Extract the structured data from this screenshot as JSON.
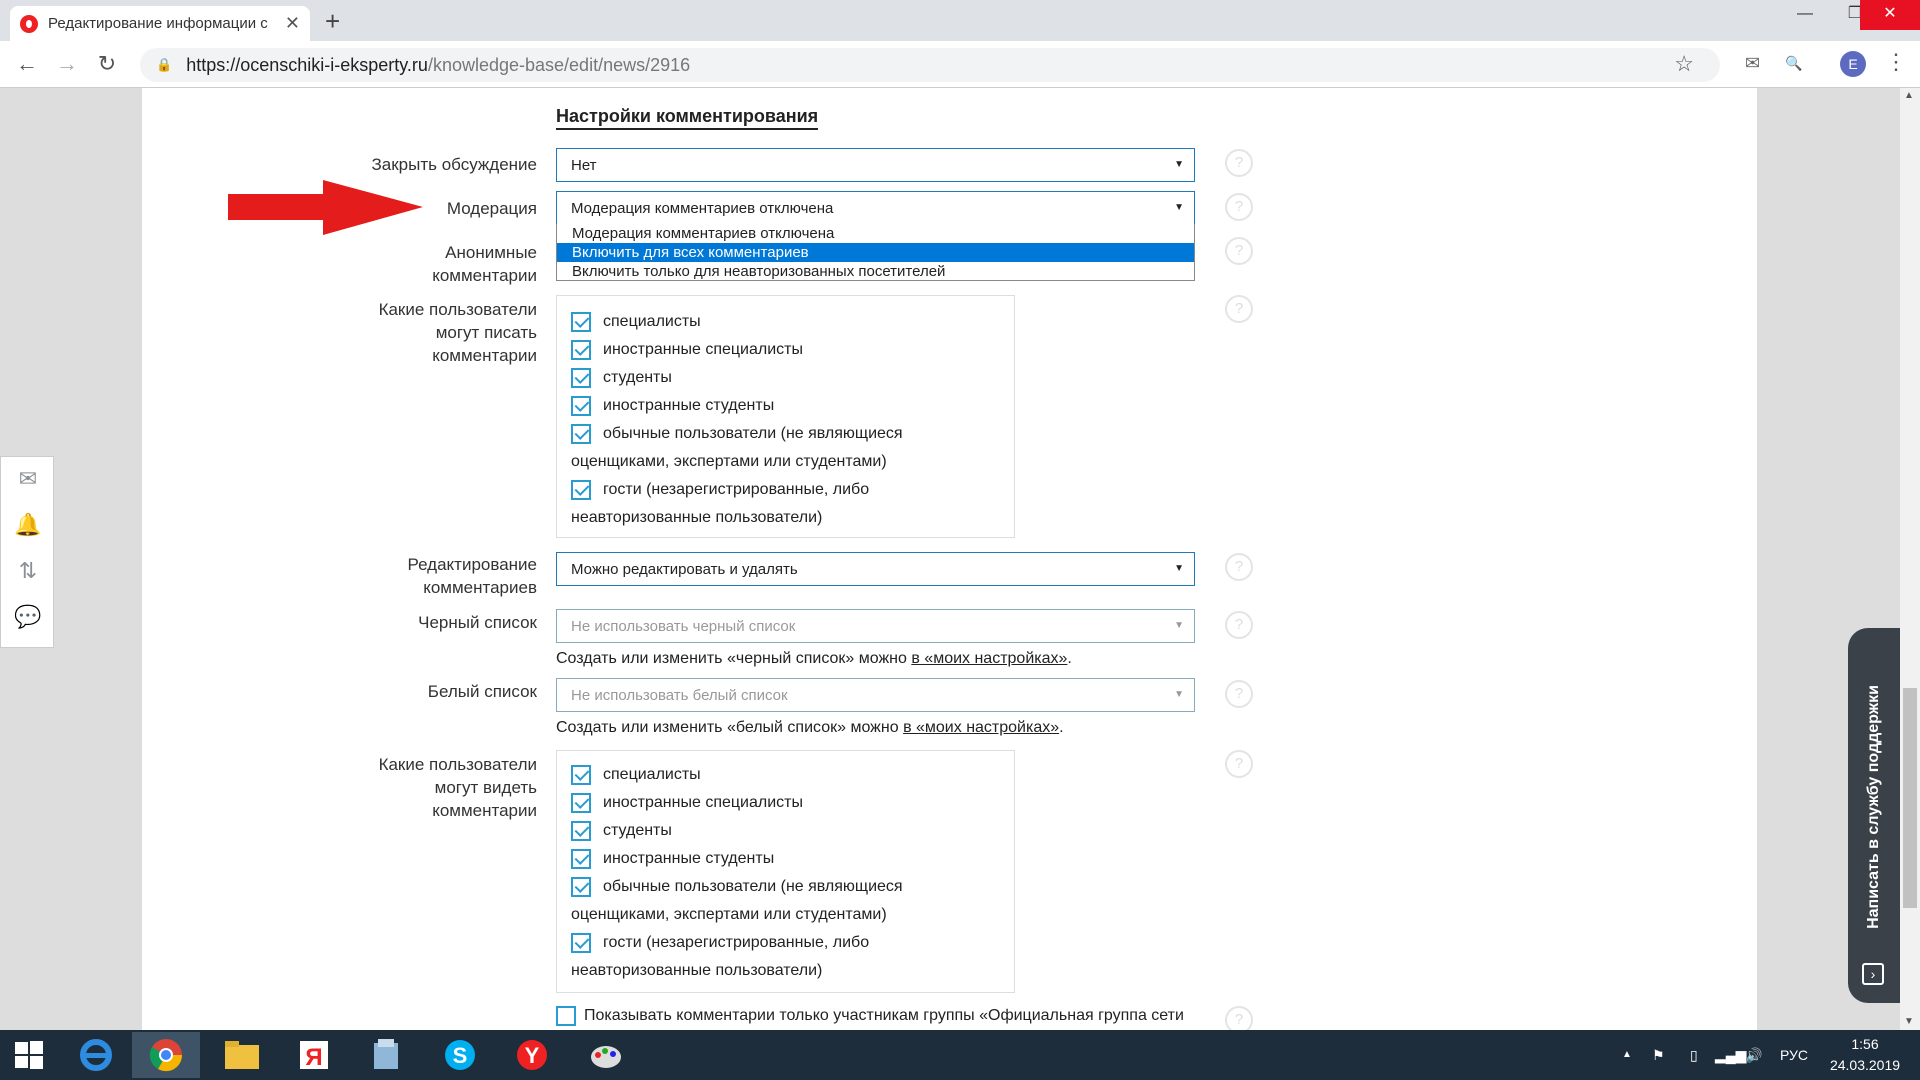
{
  "browser": {
    "tab_title": "Редактирование информации с",
    "url_host": "https://ocenschiki-i-eksperty.ru",
    "url_path": "/knowledge-base/edit/news/2916",
    "profile_initial": "E"
  },
  "page": {
    "section_title": "Настройки комментирования",
    "close_discussion": {
      "label": "Закрыть обсуждение",
      "value": "Нет"
    },
    "moderation": {
      "label": "Модерация",
      "value": "Модерация комментариев отключена",
      "options": [
        "Модерация комментариев отключена",
        "Включить для всех комментариев",
        "Включить только для неавторизованных посетителей"
      ],
      "highlighted_option_index": 1
    },
    "anonymous": {
      "label_line1": "Анонимные",
      "label_line2": "комментарии"
    },
    "who_can_write": {
      "label_line1": "Какие пользователи",
      "label_line2": "могут писать",
      "label_line3": "комментарии",
      "items": [
        {
          "text": "специалисты",
          "checked": true
        },
        {
          "text": "иностранные специалисты",
          "checked": true
        },
        {
          "text": "студенты",
          "checked": true
        },
        {
          "text": "иностранные студенты",
          "checked": true
        },
        {
          "text": "обычные пользователи (не являющиеся",
          "text2": "оценщиками, экспертами или студентами)",
          "checked": true
        },
        {
          "text": "гости (незарегистрированные, либо",
          "text2": "неавторизованные пользователи)",
          "checked": true
        }
      ]
    },
    "edit_comments": {
      "label_line1": "Редактирование",
      "label_line2": "комментариев",
      "value": "Можно редактировать и удалять"
    },
    "blacklist": {
      "label": "Черный список",
      "placeholder": "Не использовать черный список",
      "note_prefix": "Создать или изменить «черный список» можно ",
      "note_link": "в «моих настройках»",
      "note_suffix": "."
    },
    "whitelist": {
      "label": "Белый список",
      "placeholder": "Не использовать белый список",
      "note_prefix": "Создать или изменить «белый список» можно ",
      "note_link": "в «моих настройках»",
      "note_suffix": "."
    },
    "who_can_see": {
      "label_line1": "Какие пользователи",
      "label_line2": "могут видеть",
      "label_line3": "комментарии",
      "items": [
        {
          "text": "специалисты",
          "checked": true
        },
        {
          "text": "иностранные специалисты",
          "checked": true
        },
        {
          "text": "студенты",
          "checked": true
        },
        {
          "text": "иностранные студенты",
          "checked": true
        },
        {
          "text": "обычные пользователи (не являющиеся",
          "text2": "оценщиками, экспертами или студентами)",
          "checked": true
        },
        {
          "text": "гости (незарегистрированные, либо",
          "text2": "неавторизованные пользователи)",
          "checked": true
        }
      ]
    },
    "group_only": {
      "text": "Показывать комментарии только участникам группы «Официальная группа сети",
      "checked": false
    },
    "help_glyph": "?"
  },
  "support_button": "Написать в службу поддержки",
  "taskbar": {
    "lang": "РУС",
    "time": "1:56",
    "date": "24.03.2019"
  },
  "colors": {
    "accent": "#1d7bbb",
    "checkbox": "#2a9bd0",
    "selected_option": "#0078d7",
    "arrow": "#e41c1c",
    "support_bg": "#3a4148"
  }
}
